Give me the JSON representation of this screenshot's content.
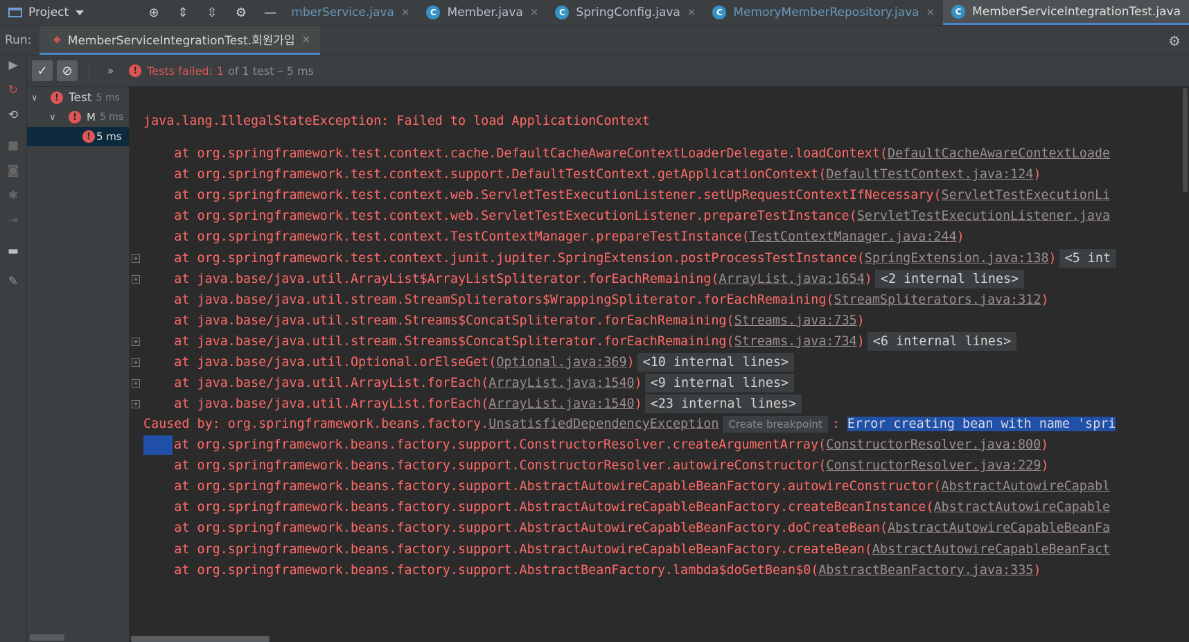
{
  "topbar": {
    "project_label": "Project",
    "tabs": [
      {
        "name": "mberService.java",
        "modified": true
      },
      {
        "name": "Member.java",
        "modified": false
      },
      {
        "name": "SpringConfig.java",
        "modified": false
      },
      {
        "name": "MemoryMemberRepository.java",
        "modified": true
      },
      {
        "name": "MemberServiceIntegrationTest.java",
        "modified": false,
        "active": true
      }
    ]
  },
  "run": {
    "label": "Run:",
    "tab_label": "MemberServiceIntegrationTest.회원가입"
  },
  "test_toolbar": {
    "status_failed": "Tests failed:",
    "failed_count": "1",
    "status_rest": "of 1 test – 5 ms"
  },
  "tree": {
    "rows": [
      {
        "name": "Test",
        "duration": "5 ms"
      },
      {
        "name": "M",
        "duration": "5 ms"
      },
      {
        "name": "",
        "duration": "5 ms"
      }
    ]
  },
  "console": {
    "exception": "java.lang.IllegalStateException: Failed to load ApplicationContext",
    "lines": [
      {
        "text": "    at org.springframework.test.context.cache.DefaultCacheAwareContextLoaderDelegate.loadContext(",
        "link": "DefaultCacheAwareContextLoade",
        "tail": "",
        "internal": ""
      },
      {
        "text": "    at org.springframework.test.context.support.DefaultTestContext.getApplicationContext(",
        "link": "DefaultTestContext.java:124",
        "tail": ")",
        "internal": ""
      },
      {
        "text": "    at org.springframework.test.context.web.ServletTestExecutionListener.setUpRequestContextIfNecessary(",
        "link": "ServletTestExecutionLi",
        "tail": "",
        "internal": ""
      },
      {
        "text": "    at org.springframework.test.context.web.ServletTestExecutionListener.prepareTestInstance(",
        "link": "ServletTestExecutionListener.java",
        "tail": "",
        "internal": ""
      },
      {
        "text": "    at org.springframework.test.context.TestContextManager.prepareTestInstance(",
        "link": "TestContextManager.java:244",
        "tail": ")",
        "internal": ""
      },
      {
        "text": "    at org.springframework.test.context.junit.jupiter.SpringExtension.postProcessTestInstance(",
        "link": "SpringExtension.java:138",
        "tail": ")",
        "internal": "<5 int"
      },
      {
        "text": "    at java.base/java.util.ArrayList$ArrayListSpliterator.forEachRemaining(",
        "link": "ArrayList.java:1654",
        "tail": ")",
        "internal": "<2 internal lines>"
      },
      {
        "text": "    at java.base/java.util.stream.StreamSpliterators$WrappingSpliterator.forEachRemaining(",
        "link": "StreamSpliterators.java:312",
        "tail": ")",
        "internal": ""
      },
      {
        "text": "    at java.base/java.util.stream.Streams$ConcatSpliterator.forEachRemaining(",
        "link": "Streams.java:735",
        "tail": ")",
        "internal": ""
      },
      {
        "text": "    at java.base/java.util.stream.Streams$ConcatSpliterator.forEachRemaining(",
        "link": "Streams.java:734",
        "tail": ")",
        "internal": "<6 internal lines>"
      },
      {
        "text": "    at java.base/java.util.Optional.orElseGet(",
        "link": "Optional.java:369",
        "tail": ")",
        "internal": "<10 internal lines>"
      },
      {
        "text": "    at java.base/java.util.ArrayList.forEach(",
        "link": "ArrayList.java:1540",
        "tail": ")",
        "internal": "<9 internal lines>"
      },
      {
        "text": "    at java.base/java.util.ArrayList.forEach(",
        "link": "ArrayList.java:1540",
        "tail": ")",
        "internal": "<23 internal lines>"
      }
    ],
    "caused_by_prefix": "Caused by: org.springframework.beans.factory.",
    "caused_by_link": "UnsatisfiedDependencyException",
    "create_breakpoint": "Create breakpoint",
    "caused_by_mid": ": ",
    "caused_by_selected": "Error creating bean with name 'spri",
    "lines2": [
      {
        "text": "at org.springframework.beans.factory.support.ConstructorResolver.createArgumentArray(",
        "link": "ConstructorResolver.java:800",
        "tail": ")"
      },
      {
        "text": "    at org.springframework.beans.factory.support.ConstructorResolver.autowireConstructor(",
        "link": "ConstructorResolver.java:229",
        "tail": ")"
      },
      {
        "text": "    at org.springframework.beans.factory.support.AbstractAutowireCapableBeanFactory.autowireConstructor(",
        "link": "AbstractAutowireCapabl",
        "tail": ""
      },
      {
        "text": "    at org.springframework.beans.factory.support.AbstractAutowireCapableBeanFactory.createBeanInstance(",
        "link": "AbstractAutowireCapable",
        "tail": ""
      },
      {
        "text": "    at org.springframework.beans.factory.support.AbstractAutowireCapableBeanFactory.doCreateBean(",
        "link": "AbstractAutowireCapableBeanFa",
        "tail": ""
      },
      {
        "text": "    at org.springframework.beans.factory.support.AbstractAutowireCapableBeanFactory.createBean(",
        "link": "AbstractAutowireCapableBeanFact",
        "tail": ""
      },
      {
        "text": "    at org.springframework.beans.factory.support.AbstractBeanFactory.lambda$doGetBean$0(",
        "link": "AbstractBeanFactory.java:335",
        "tail": ")"
      }
    ]
  }
}
